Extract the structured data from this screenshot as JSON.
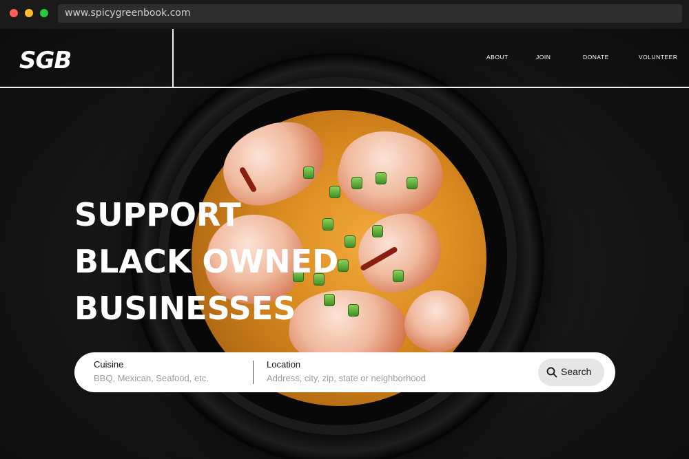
{
  "browser": {
    "url": "www.spicygreenbook.com"
  },
  "nav": {
    "logo": "SGB",
    "links": [
      "ABOUT",
      "JOIN",
      "DONATE",
      "VOLUNTEER"
    ]
  },
  "hero": {
    "headline_lines": [
      "SUPPORT",
      "BLACK OWNED",
      "BUSINESSES"
    ]
  },
  "search": {
    "cuisine_label": "Cuisine",
    "cuisine_placeholder": "BBQ, Mexican, Seafood, etc.",
    "location_label": "Location",
    "location_placeholder": "Address, city, zip, state or neighborhood",
    "button_label": "Search"
  },
  "colors": {
    "background": "#111111",
    "text": "#ffffff",
    "search_button": "#e6e6e6"
  },
  "icons": [
    "search-icon"
  ]
}
